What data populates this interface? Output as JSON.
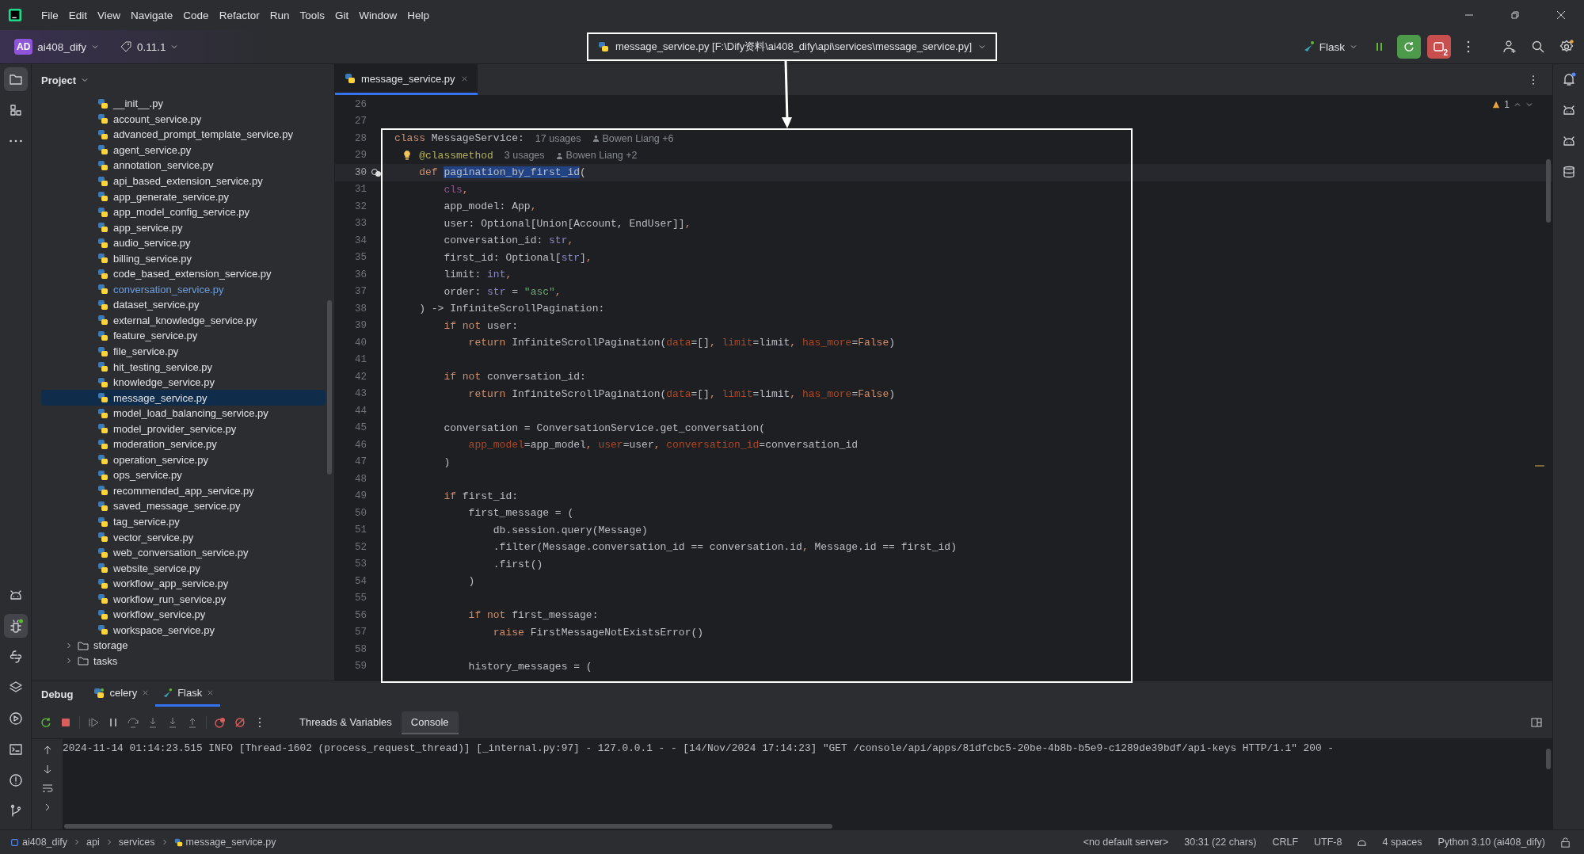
{
  "menu": [
    "File",
    "Edit",
    "View",
    "Navigate",
    "Code",
    "Refactor",
    "Run",
    "Tools",
    "Git",
    "Window",
    "Help"
  ],
  "toolbar": {
    "project_badge": "AD",
    "project": "ai408_dify",
    "version": "0.11.1",
    "current_file": "message_service.py [F:\\Dify资料\\ai408_dify\\api\\services\\message_service.py]",
    "run_config": "Flask",
    "stop_badge": "2"
  },
  "left_tools": [
    {
      "kind": "folder",
      "selected": true
    },
    {
      "kind": "structure",
      "selected": false
    },
    {
      "kind": "more",
      "selected": false
    }
  ],
  "left_tools_bottom": [
    {
      "kind": "ai",
      "selected": false
    },
    {
      "kind": "debug",
      "selected": true
    },
    {
      "kind": "python",
      "selected": false
    },
    {
      "kind": "layers",
      "selected": false
    },
    {
      "kind": "run",
      "selected": false
    },
    {
      "kind": "terminal",
      "selected": false
    },
    {
      "kind": "problems",
      "selected": false
    },
    {
      "kind": "git",
      "selected": false
    }
  ],
  "right_tools": [
    {
      "kind": "bell",
      "unread": true
    },
    {
      "kind": "ai",
      "unread": false
    },
    {
      "kind": "ai",
      "unread": false
    },
    {
      "kind": "database",
      "unread": false
    }
  ],
  "project_panel": {
    "title": "Project",
    "files": [
      {
        "label": "__init__.py",
        "selected": false,
        "modified": false
      },
      {
        "label": "account_service.py",
        "selected": false,
        "modified": false
      },
      {
        "label": "advanced_prompt_template_service.py",
        "selected": false,
        "modified": false
      },
      {
        "label": "agent_service.py",
        "selected": false,
        "modified": false
      },
      {
        "label": "annotation_service.py",
        "selected": false,
        "modified": false
      },
      {
        "label": "api_based_extension_service.py",
        "selected": false,
        "modified": false
      },
      {
        "label": "app_generate_service.py",
        "selected": false,
        "modified": false
      },
      {
        "label": "app_model_config_service.py",
        "selected": false,
        "modified": false
      },
      {
        "label": "app_service.py",
        "selected": false,
        "modified": false
      },
      {
        "label": "audio_service.py",
        "selected": false,
        "modified": false
      },
      {
        "label": "billing_service.py",
        "selected": false,
        "modified": false
      },
      {
        "label": "code_based_extension_service.py",
        "selected": false,
        "modified": false
      },
      {
        "label": "conversation_service.py",
        "selected": false,
        "modified": true
      },
      {
        "label": "dataset_service.py",
        "selected": false,
        "modified": false
      },
      {
        "label": "external_knowledge_service.py",
        "selected": false,
        "modified": false
      },
      {
        "label": "feature_service.py",
        "selected": false,
        "modified": false
      },
      {
        "label": "file_service.py",
        "selected": false,
        "modified": false
      },
      {
        "label": "hit_testing_service.py",
        "selected": false,
        "modified": false
      },
      {
        "label": "knowledge_service.py",
        "selected": false,
        "modified": false
      },
      {
        "label": "message_service.py",
        "selected": true,
        "modified": false
      },
      {
        "label": "model_load_balancing_service.py",
        "selected": false,
        "modified": false
      },
      {
        "label": "model_provider_service.py",
        "selected": false,
        "modified": false
      },
      {
        "label": "moderation_service.py",
        "selected": false,
        "modified": false
      },
      {
        "label": "operation_service.py",
        "selected": false,
        "modified": false
      },
      {
        "label": "ops_service.py",
        "selected": false,
        "modified": false
      },
      {
        "label": "recommended_app_service.py",
        "selected": false,
        "modified": false
      },
      {
        "label": "saved_message_service.py",
        "selected": false,
        "modified": false
      },
      {
        "label": "tag_service.py",
        "selected": false,
        "modified": false
      },
      {
        "label": "vector_service.py",
        "selected": false,
        "modified": false
      },
      {
        "label": "web_conversation_service.py",
        "selected": false,
        "modified": false
      },
      {
        "label": "website_service.py",
        "selected": false,
        "modified": false
      },
      {
        "label": "workflow_app_service.py",
        "selected": false,
        "modified": false
      },
      {
        "label": "workflow_run_service.py",
        "selected": false,
        "modified": false
      },
      {
        "label": "workflow_service.py",
        "selected": false,
        "modified": false
      },
      {
        "label": "workspace_service.py",
        "selected": false,
        "modified": false
      }
    ],
    "folders": [
      {
        "label": "storage",
        "expanded": false
      },
      {
        "label": "tasks",
        "expanded": false
      }
    ]
  },
  "editor": {
    "tabs": [
      {
        "label": "message_service.py",
        "selected": true
      }
    ],
    "warnings": "1",
    "lines": [
      {
        "number": "26"
      },
      {
        "number": "27"
      },
      {
        "number": "28",
        "code": [
          {
            "kind": "kw",
            "text": "class "
          },
          {
            "kind": "plain",
            "text": "MessageService:"
          }
        ],
        "hints": [
          {
            "kind": "usages",
            "text": "17 usages"
          },
          {
            "kind": "author",
            "text": "Bowen Liang +6"
          }
        ]
      },
      {
        "number": "29",
        "bulb": true,
        "code": [
          {
            "kind": "deco",
            "text": "@classmethod"
          }
        ],
        "hints": [
          {
            "kind": "usages",
            "text": "3 usages"
          },
          {
            "kind": "author",
            "text": "Bowen Liang +2"
          }
        ]
      },
      {
        "number": "30",
        "current": true,
        "marker": true,
        "code": [
          {
            "kind": "kw",
            "text": "    def "
          },
          {
            "kind": "selected",
            "text": "pagination_by_first_id"
          },
          {
            "kind": "plain",
            "text": "("
          }
        ]
      },
      {
        "number": "31",
        "code": [
          {
            "kind": "self",
            "text": "        cls"
          },
          {
            "kind": "kw",
            "text": ","
          }
        ]
      },
      {
        "number": "32",
        "code": [
          {
            "kind": "plain",
            "text": "        app_model: App"
          },
          {
            "kind": "kw",
            "text": ","
          }
        ]
      },
      {
        "number": "33",
        "code": [
          {
            "kind": "plain",
            "text": "        user: Optional[Union[Account, EndUser]]"
          },
          {
            "kind": "kw",
            "text": ","
          }
        ]
      },
      {
        "number": "34",
        "code": [
          {
            "kind": "plain",
            "text": "        conversation_id: "
          },
          {
            "kind": "builtin",
            "text": "str"
          },
          {
            "kind": "kw",
            "text": ","
          }
        ]
      },
      {
        "number": "35",
        "code": [
          {
            "kind": "plain",
            "text": "        first_id: Optional["
          },
          {
            "kind": "builtin",
            "text": "str"
          },
          {
            "kind": "plain",
            "text": "]"
          },
          {
            "kind": "kw",
            "text": ","
          }
        ]
      },
      {
        "number": "36",
        "code": [
          {
            "kind": "plain",
            "text": "        limit: "
          },
          {
            "kind": "builtin",
            "text": "int"
          },
          {
            "kind": "kw",
            "text": ","
          }
        ]
      },
      {
        "number": "37",
        "code": [
          {
            "kind": "plain",
            "text": "        order: "
          },
          {
            "kind": "builtin",
            "text": "str"
          },
          {
            "kind": "plain",
            "text": " = "
          },
          {
            "kind": "string",
            "text": "\"asc\""
          },
          {
            "kind": "kw",
            "text": ","
          }
        ]
      },
      {
        "number": "38",
        "code": [
          {
            "kind": "plain",
            "text": "    ) -> InfiniteScrollPagination:"
          }
        ]
      },
      {
        "number": "39",
        "code": [
          {
            "kind": "kw",
            "text": "        if not "
          },
          {
            "kind": "plain",
            "text": "user:"
          }
        ]
      },
      {
        "number": "40",
        "code": [
          {
            "kind": "kw",
            "text": "            return "
          },
          {
            "kind": "plain",
            "text": "InfiniteScrollPagination("
          },
          {
            "kind": "named",
            "text": "data"
          },
          {
            "kind": "plain",
            "text": "=[]"
          },
          {
            "kind": "kw",
            "text": ", "
          },
          {
            "kind": "named",
            "text": "limit"
          },
          {
            "kind": "plain",
            "text": "=limit"
          },
          {
            "kind": "kw",
            "text": ", "
          },
          {
            "kind": "named",
            "text": "has_more"
          },
          {
            "kind": "plain",
            "text": "="
          },
          {
            "kind": "kw",
            "text": "False"
          },
          {
            "kind": "plain",
            "text": ")"
          }
        ]
      },
      {
        "number": "41"
      },
      {
        "number": "42",
        "code": [
          {
            "kind": "kw",
            "text": "        if not "
          },
          {
            "kind": "plain",
            "text": "conversation_id:"
          }
        ]
      },
      {
        "number": "43",
        "code": [
          {
            "kind": "kw",
            "text": "            return "
          },
          {
            "kind": "plain",
            "text": "InfiniteScrollPagination("
          },
          {
            "kind": "named",
            "text": "data"
          },
          {
            "kind": "plain",
            "text": "=[]"
          },
          {
            "kind": "kw",
            "text": ", "
          },
          {
            "kind": "named",
            "text": "limit"
          },
          {
            "kind": "plain",
            "text": "=limit"
          },
          {
            "kind": "kw",
            "text": ", "
          },
          {
            "kind": "named",
            "text": "has_more"
          },
          {
            "kind": "plain",
            "text": "="
          },
          {
            "kind": "kw",
            "text": "False"
          },
          {
            "kind": "plain",
            "text": ")"
          }
        ]
      },
      {
        "number": "44"
      },
      {
        "number": "45",
        "code": [
          {
            "kind": "plain",
            "text": "        conversation = ConversationService.get_conversation("
          }
        ]
      },
      {
        "number": "46",
        "code": [
          {
            "kind": "named",
            "text": "            app_model"
          },
          {
            "kind": "plain",
            "text": "=app_model"
          },
          {
            "kind": "kw",
            "text": ", "
          },
          {
            "kind": "named",
            "text": "user"
          },
          {
            "kind": "plain",
            "text": "=user"
          },
          {
            "kind": "kw",
            "text": ", "
          },
          {
            "kind": "named",
            "text": "conversation_id"
          },
          {
            "kind": "plain",
            "text": "=conversation_id"
          }
        ]
      },
      {
        "number": "47",
        "code": [
          {
            "kind": "plain",
            "text": "        )"
          }
        ]
      },
      {
        "number": "48"
      },
      {
        "number": "49",
        "code": [
          {
            "kind": "kw",
            "text": "        if "
          },
          {
            "kind": "plain",
            "text": "first_id:"
          }
        ]
      },
      {
        "number": "50",
        "code": [
          {
            "kind": "plain",
            "text": "            first_message = ("
          }
        ]
      },
      {
        "number": "51",
        "code": [
          {
            "kind": "plain",
            "text": "                db.session.query(Message)"
          }
        ]
      },
      {
        "number": "52",
        "code": [
          {
            "kind": "plain",
            "text": "                .filter(Message.conversation_id == conversation.id"
          },
          {
            "kind": "kw",
            "text": ","
          },
          {
            "kind": "plain",
            "text": " Message.id == first_id)"
          }
        ]
      },
      {
        "number": "53",
        "code": [
          {
            "kind": "plain",
            "text": "                .first()"
          }
        ]
      },
      {
        "number": "54",
        "code": [
          {
            "kind": "plain",
            "text": "            )"
          }
        ]
      },
      {
        "number": "55"
      },
      {
        "number": "56",
        "code": [
          {
            "kind": "kw",
            "text": "            if not "
          },
          {
            "kind": "plain",
            "text": "first_message:"
          }
        ]
      },
      {
        "number": "57",
        "code": [
          {
            "kind": "kw",
            "text": "                raise "
          },
          {
            "kind": "plain",
            "text": "FirstMessageNotExistsError()"
          }
        ]
      },
      {
        "number": "58"
      },
      {
        "number": "59",
        "code": [
          {
            "kind": "plain",
            "text": "            history_messages = ("
          }
        ]
      }
    ]
  },
  "debug_panel": {
    "title": "Debug",
    "sessions": [
      {
        "label": "celery",
        "kind": "python",
        "selected": false
      },
      {
        "label": "Flask",
        "kind": "flask",
        "selected": true
      }
    ],
    "views": [
      {
        "label": "Threads & Variables",
        "selected": false
      },
      {
        "label": "Console",
        "selected": true
      }
    ],
    "console": [
      "2024-11-14 01:14:23.515 INFO [Thread-1602 (process_request_thread)] [_internal.py:97] - 127.0.0.1 - - [14/Nov/2024 17:14:23] \"GET /console/api/apps/81dfcbc5-20be-4b8b-b5e9-c1289de39bdf/api-keys HTTP/1.1\" 200 -"
    ]
  },
  "status_bar": {
    "breadcrumbs": [
      "ai408_dify",
      "api",
      "services",
      "message_service.py"
    ],
    "items_left": [
      "<no default server>",
      "30:31 (22 chars)",
      "CRLF",
      "UTF-8"
    ],
    "items_right": [
      "4 spaces",
      "Python 3.10 (ai408_dify)"
    ]
  }
}
